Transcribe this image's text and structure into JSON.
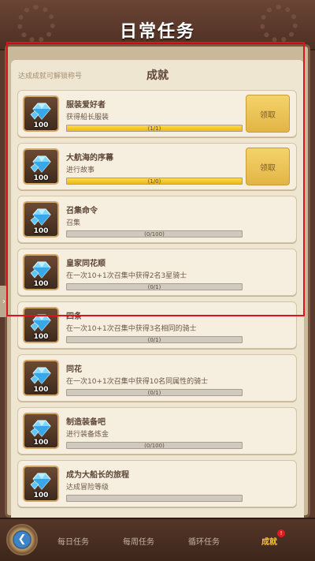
{
  "header": {
    "title": "日常任务"
  },
  "panel": {
    "hint": "达成成就可解锁称号",
    "title": "成就"
  },
  "achievements": [
    {
      "title": "服装爱好者",
      "desc": "获得船长服装",
      "progress_text": "(1/1)",
      "progress": 1.0,
      "reward": "100",
      "claim_label": "领取"
    },
    {
      "title": "大航海的序幕",
      "desc": "进行故事",
      "progress_text": "(1/0)",
      "progress": 1.0,
      "reward": "100",
      "claim_label": "领取"
    },
    {
      "title": "召集命令",
      "desc": "召集",
      "progress_text": "(0/100)",
      "progress": 0.0,
      "reward": "100"
    },
    {
      "title": "皇家同花顺",
      "desc": "在一次10+1次召集中获得2名3星骑士",
      "progress_text": "(0/1)",
      "progress": 0.0,
      "reward": "100"
    },
    {
      "title": "四条",
      "desc": "在一次10+1次召集中获得3名相同的骑士",
      "progress_text": "(0/1)",
      "progress": 0.0,
      "reward": "100"
    },
    {
      "title": "同花",
      "desc": "在一次10+1次召集中获得10名同属性的骑士",
      "progress_text": "(0/1)",
      "progress": 0.0,
      "reward": "100"
    },
    {
      "title": "制造装备吧",
      "desc": "进行装备炼金",
      "progress_text": "(0/100)",
      "progress": 0.0,
      "reward": "100"
    },
    {
      "title": "成为大船长的旅程",
      "desc": "达成冒险等级",
      "progress_text": "",
      "progress": 0.0,
      "reward": "100"
    }
  ],
  "nav": {
    "tabs": [
      {
        "label": "每日任务"
      },
      {
        "label": "每周任务"
      },
      {
        "label": "循环任务"
      },
      {
        "label": "成就",
        "active": true,
        "badge": "!"
      }
    ]
  },
  "colors": {
    "accent": "#f6c23b",
    "highlight": "#e0121b",
    "progress": "#f0b814"
  }
}
